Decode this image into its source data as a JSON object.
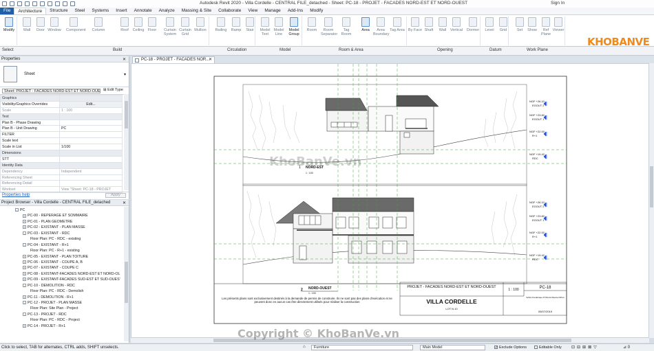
{
  "window": {
    "title": "Autodesk Revit 2020 - Villa Cordelle - CENTRAL FILE_detached - Sheet: PC-18 - PROJET - FACADES NORD-EST ET NORD-OUEST",
    "sign_in": "Sign In"
  },
  "tabs": [
    "File",
    "Architecture",
    "Structure",
    "Steel",
    "Systems",
    "Insert",
    "Annotate",
    "Analyze",
    "Massing & Site",
    "Collaborate",
    "View",
    "Manage",
    "Add-Ins",
    "Modify"
  ],
  "ribbon": {
    "tools": [
      "Modify",
      "Wall",
      "Door",
      "Window",
      "Component",
      "Column",
      "Roof",
      "Ceiling",
      "Floor",
      "Curtain System",
      "Curtain Grid",
      "Mullion",
      "Railing",
      "Ramp",
      "Stair",
      "Model Text",
      "Model Line",
      "Model Group",
      "Room",
      "Room Separator",
      "Tag Room",
      "Area",
      "Area Boundary",
      "Tag Area",
      "By Face",
      "Shaft",
      "Wall",
      "Vertical",
      "Dormer",
      "Level",
      "Grid",
      "Set",
      "Show",
      "Ref Plane",
      "Viewer"
    ],
    "panels": [
      "Select",
      "Build",
      "Circulation",
      "Model",
      "Room & Area",
      "Opening",
      "Datum",
      "Work Plane"
    ]
  },
  "logo": {
    "text": "KHOBANVE"
  },
  "properties": {
    "title": "Properties",
    "family": "Sheet",
    "instance": "Sheet: PROJET - FACADES NORD-EST ET NORD-OUES",
    "edit_type": "Edit Type",
    "rows": [
      {
        "k": "Graphics",
        "v": "",
        "group": true
      },
      {
        "k": "Visibility/Graphics Overrides",
        "v": "Edit...",
        "btn": true
      },
      {
        "k": "Scale",
        "v": "1 : 100",
        "dim": true
      },
      {
        "k": "Text",
        "v": "",
        "group": true
      },
      {
        "k": "Plan B - Phase Drawing",
        "v": ""
      },
      {
        "k": "Plan B - Unit Drawing",
        "v": "PC"
      },
      {
        "k": "FILTER",
        "v": ""
      },
      {
        "k": "Scale text",
        "v": ""
      },
      {
        "k": "Scale in List",
        "v": "1/100"
      },
      {
        "k": "Dimensions",
        "v": "",
        "group": true
      },
      {
        "k": "STT",
        "v": ""
      },
      {
        "k": "Identity Data",
        "v": "",
        "group": true
      },
      {
        "k": "Dependency",
        "v": "Independent",
        "dim": true
      },
      {
        "k": "Referencing Sheet",
        "v": "",
        "dim": true
      },
      {
        "k": "Referencing Detail",
        "v": "",
        "dim": true
      },
      {
        "k": "Workset",
        "v": "View \"Sheet: PC-18 - PROJET",
        "dim": true
      }
    ],
    "help": "Properties help",
    "apply": "Apply"
  },
  "browser": {
    "title": "Project Browser - Villa Cordelle - CENTRAL FILE_detached",
    "items": [
      {
        "label": "PC",
        "indent": 0,
        "exp": "-"
      },
      {
        "label": "PC-00 - REPERAGE ET SOMMAIRE",
        "indent": 1,
        "exp": "+"
      },
      {
        "label": "PC-01 - PLAN GEOMETRE",
        "indent": 1,
        "exp": "+"
      },
      {
        "label": "PC-02 - EXISTANT - PLAN MASSE",
        "indent": 1,
        "exp": "+"
      },
      {
        "label": "PC-03 - EXISTANT - RDC",
        "indent": 1,
        "exp": "-"
      },
      {
        "label": "Floor Plan: PC - RDC - existing",
        "indent": 2,
        "exp": ""
      },
      {
        "label": "PC-04 - EXISTANT - R+1",
        "indent": 1,
        "exp": "-"
      },
      {
        "label": "Floor Plan: PC - R+1 - existing",
        "indent": 2,
        "exp": ""
      },
      {
        "label": "PC-05 - EXISTANT - PLAN TOITURE",
        "indent": 1,
        "exp": "+"
      },
      {
        "label": "PC-06 - EXISTANT - COUPE A, B",
        "indent": 1,
        "exp": "+"
      },
      {
        "label": "PC-07 - EXISTANT - COUPE C",
        "indent": 1,
        "exp": "+"
      },
      {
        "label": "PC-08 - EXISTANT-FACADES NORD-EST ET NORD-OL",
        "indent": 1,
        "exp": "+"
      },
      {
        "label": "PC-09 - EXISTANT-FACADES SUD-EST ET SUD-OUES'",
        "indent": 1,
        "exp": "+"
      },
      {
        "label": "PC-10 - DEMOLITION - RDC",
        "indent": 1,
        "exp": "-"
      },
      {
        "label": "Floor Plan: PC - RDC - Demolish",
        "indent": 2,
        "exp": ""
      },
      {
        "label": "PC-11 - DEMOLITION - R+1",
        "indent": 1,
        "exp": "+"
      },
      {
        "label": "PC-12 - PROJET - PLAN MASSE",
        "indent": 1,
        "exp": "-"
      },
      {
        "label": "Floor Plan: Site Plan - Project",
        "indent": 2,
        "exp": ""
      },
      {
        "label": "PC-13 - PROJET - RDC",
        "indent": 1,
        "exp": "-"
      },
      {
        "label": "Floor Plan: PC - RDC - Project",
        "indent": 2,
        "exp": ""
      },
      {
        "label": "PC-14 - PROJET - R+1",
        "indent": 1,
        "exp": "+"
      }
    ]
  },
  "view_tab": {
    "label": "PC-18 - PROJET - FACADES NOR..."
  },
  "sheet": {
    "title_block": {
      "project": "PROJET - FACADES NORD-EST ET NORD-OUEST",
      "scale": "1 : 100",
      "number": "PC-18",
      "name": "VILLA CORDELLE",
      "lot": "LOT N.10",
      "date": "05/07/2019",
      "architect": "SASU Frédérique PYRA Architecte DPLG",
      "notice": "Les présents plans sont exclusivement destinés à la demande de permis de construire. Ils ne sont pas des plans d'exécution et ne peuvent donc en aucun cas être directement utilisés pour réaliser la construction"
    },
    "view1": {
      "num": "1",
      "name": "NORD-EST",
      "scale": "1 : 100"
    },
    "view2": {
      "num": "2",
      "name": "NORD-OUEST",
      "scale": "1 : 100"
    },
    "levels_top": [
      "NGF +26.10",
      "EGOUT 2",
      "NGF +23.60",
      "EGOUT 1",
      "NGF +22.00",
      "R+1",
      "NGF +19.42",
      "RDC"
    ],
    "levels_bottom": [
      "NGF +26.10",
      "EGOUT 2",
      "NGF +23.60",
      "EGOUT 1",
      "NGF +22.00",
      "R+1",
      "NGF +19.42",
      "RDC"
    ],
    "annotations": [
      "FAITAGE +26.10",
      "FAITAGE +26.80",
      "EGOUT +26.10",
      "EGOUT +23.60",
      "FAITAGE +26.10",
      "EGOUT +26.10"
    ]
  },
  "watermarks": [
    "KhoBanVe.vn",
    "Copyright © KhoBanVe.vn"
  ],
  "status": {
    "message": "Click to select, TAB for alternates, CTRL adds, SHIFT unselects.",
    "workset": "Furniture",
    "model": "Main Model",
    "exclude_options": "Exclude Options",
    "editable_only": "Editable Only"
  },
  "colors": {
    "file_tab": "#1e5fa8",
    "logo": "#f08a1b",
    "level_marker": "#1f4fd1",
    "grid": "#3aa63a"
  }
}
